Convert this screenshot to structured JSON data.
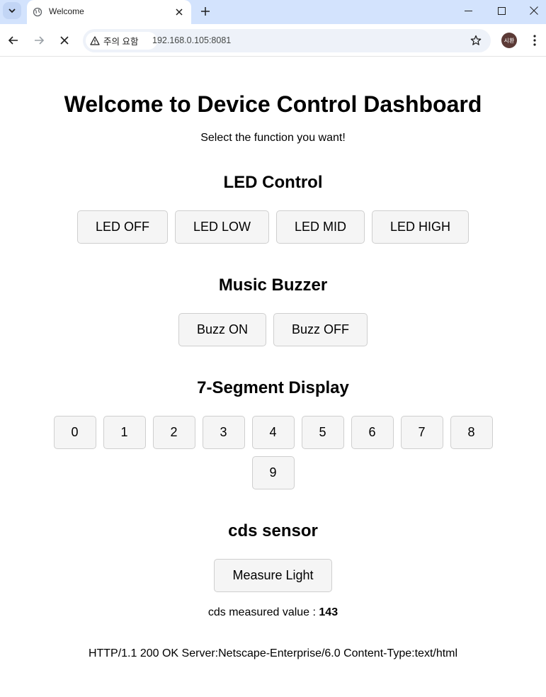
{
  "browser": {
    "tab_title": "Welcome",
    "security_label": "주의 요함",
    "url_host": "192.168.0.105",
    "url_port": ":8081",
    "avatar_text": "시환"
  },
  "page": {
    "title": "Welcome to Device Control Dashboard",
    "subtitle": "Select the function you want!",
    "led": {
      "heading": "LED Control",
      "buttons": [
        "LED OFF",
        "LED LOW",
        "LED MID",
        "LED HIGH"
      ]
    },
    "buzzer": {
      "heading": "Music Buzzer",
      "buttons": [
        "Buzz ON",
        "Buzz OFF"
      ]
    },
    "segment": {
      "heading": "7-Segment Display",
      "digits": [
        "0",
        "1",
        "2",
        "3",
        "4",
        "5",
        "6",
        "7",
        "8",
        "9"
      ]
    },
    "cds": {
      "heading": "cds sensor",
      "button": "Measure Light",
      "measured_label": "cds measured value : ",
      "measured_value": "143"
    },
    "http_response": "HTTP/1.1 200 OK Server:Netscape-Enterprise/6.0 Content-Type:text/html"
  }
}
